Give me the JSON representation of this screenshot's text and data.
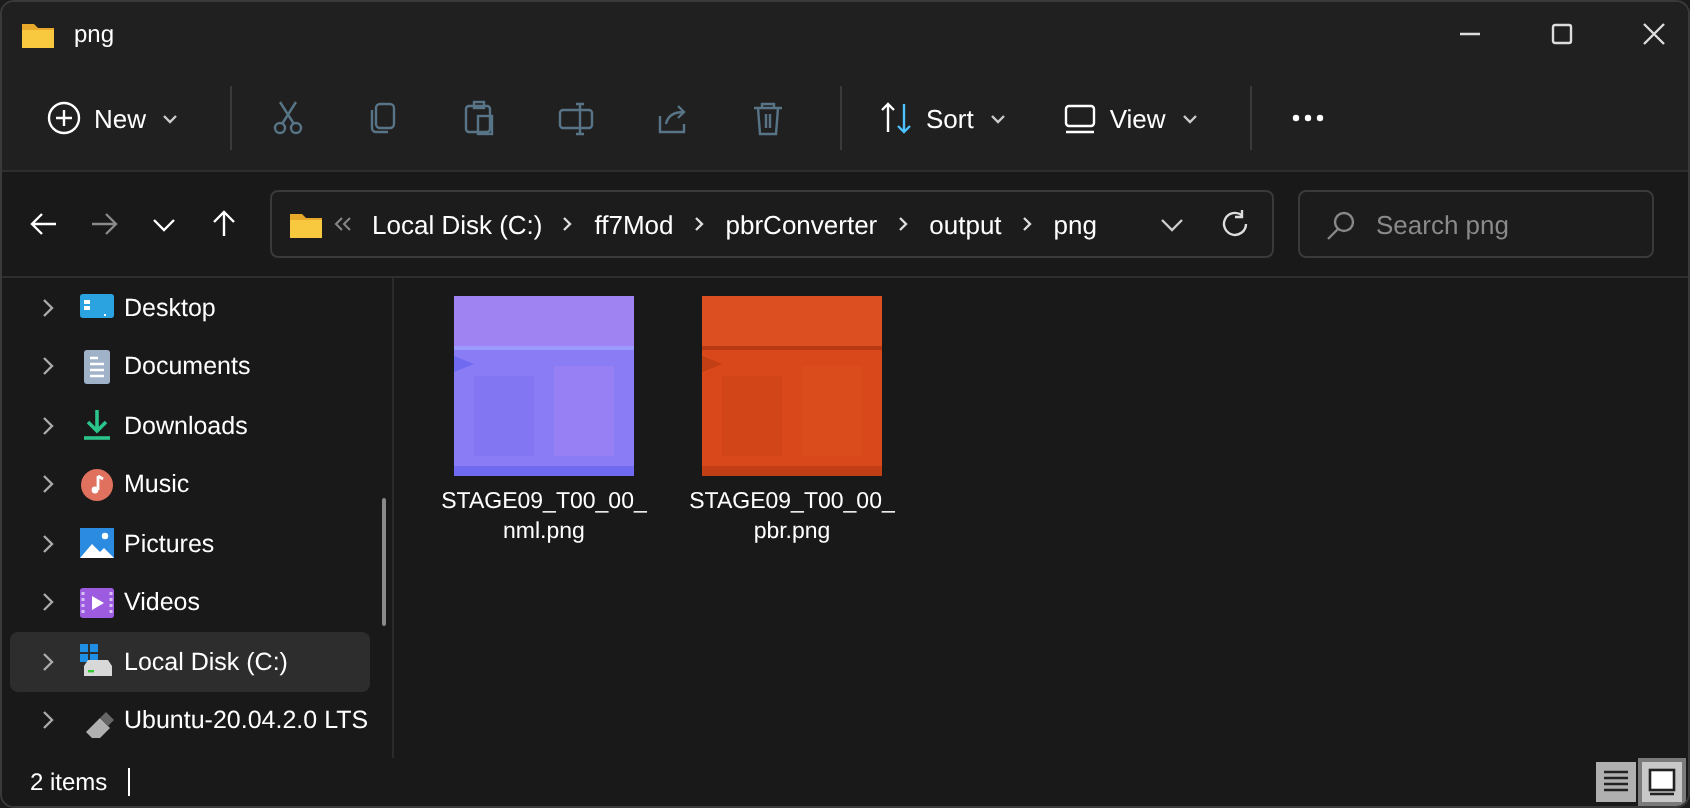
{
  "window": {
    "title": "png"
  },
  "toolbar": [
    {
      "kind": "new",
      "label": "New",
      "disabled": false
    },
    {
      "kind": "cut",
      "disabled": true
    },
    {
      "kind": "copy",
      "disabled": true
    },
    {
      "kind": "paste",
      "disabled": true
    },
    {
      "kind": "rename",
      "disabled": true
    },
    {
      "kind": "share",
      "disabled": true
    },
    {
      "kind": "delete",
      "disabled": true
    },
    {
      "kind": "sort",
      "label": "Sort",
      "disabled": false
    },
    {
      "kind": "view",
      "label": "View",
      "disabled": false
    },
    {
      "kind": "more",
      "disabled": false
    }
  ],
  "nav_buttons": [
    {
      "kind": "back",
      "disabled": false
    },
    {
      "kind": "forward",
      "disabled": true
    },
    {
      "kind": "recent",
      "disabled": false
    },
    {
      "kind": "up",
      "disabled": false
    }
  ],
  "address_bar": {
    "segments": [
      "Local Disk (C:)",
      "ff7Mod",
      "pbrConverter",
      "output",
      "png"
    ]
  },
  "search": {
    "placeholder": "Search png"
  },
  "sidebar": {
    "items": [
      {
        "kind": "desktop",
        "label": "Desktop",
        "selected": false
      },
      {
        "kind": "documents",
        "label": "Documents",
        "selected": false
      },
      {
        "kind": "downloads",
        "label": "Downloads",
        "selected": false
      },
      {
        "kind": "music",
        "label": "Music",
        "selected": false
      },
      {
        "kind": "pictures",
        "label": "Pictures",
        "selected": false
      },
      {
        "kind": "videos",
        "label": "Videos",
        "selected": false
      },
      {
        "kind": "disk",
        "label": "Local Disk (C:)",
        "selected": true
      },
      {
        "kind": "drive",
        "label": "Ubuntu-20.04.2.0 LTS",
        "selected": false
      }
    ]
  },
  "files": [
    {
      "name": "STAGE09_T00_00_nml.png",
      "kind": "picture"
    },
    {
      "name": "STAGE09_T00_00_pbr.png",
      "kind": "picture"
    }
  ],
  "status_bar": {
    "count": "2 items",
    "views": [
      {
        "kind": "details",
        "selected": false
      },
      {
        "kind": "tiles",
        "selected": true
      }
    ]
  }
}
